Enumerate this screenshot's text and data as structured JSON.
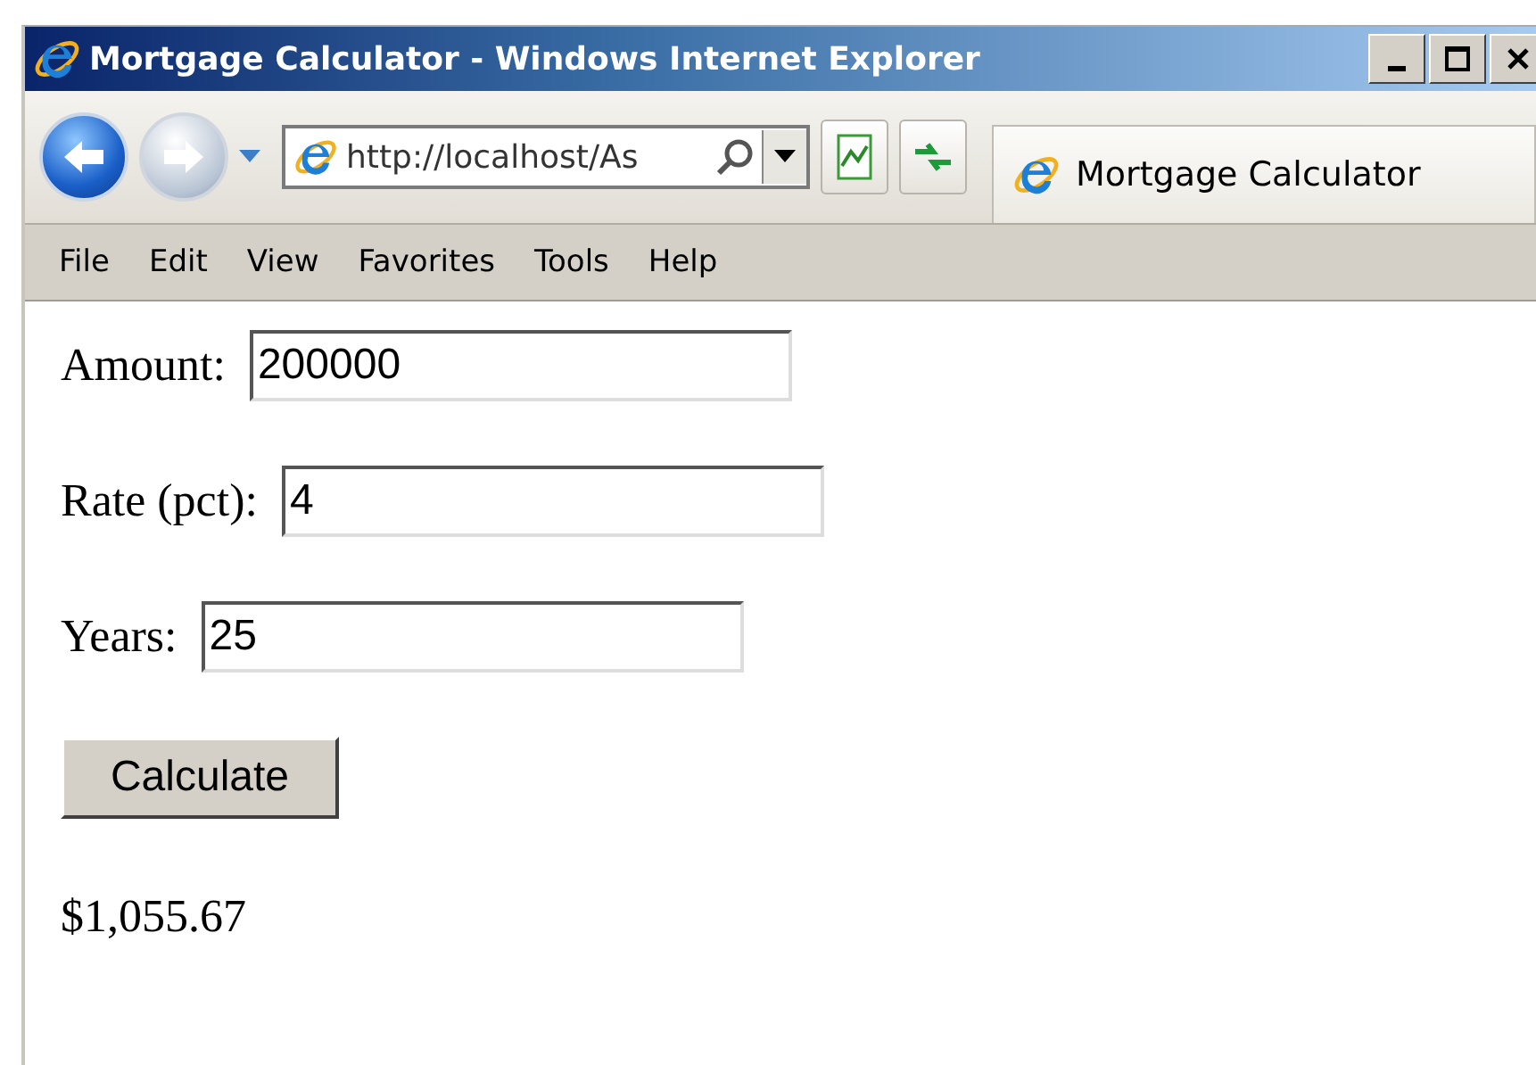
{
  "window": {
    "title": "Mortgage Calculator - Windows Internet Explorer"
  },
  "address_bar": {
    "value": "http://localhost/As"
  },
  "tab": {
    "title": "Mortgage Calculator",
    "selected": true
  },
  "menu": [
    "File",
    "Edit",
    "View",
    "Favorites",
    "Tools",
    "Help"
  ],
  "form": {
    "fields": [
      {
        "label": "Amount:",
        "value": "200000"
      },
      {
        "label": "Rate (pct):",
        "value": "4"
      },
      {
        "label": "Years:",
        "value": "25"
      }
    ],
    "button": "Calculate",
    "result": "$1,055.67"
  }
}
